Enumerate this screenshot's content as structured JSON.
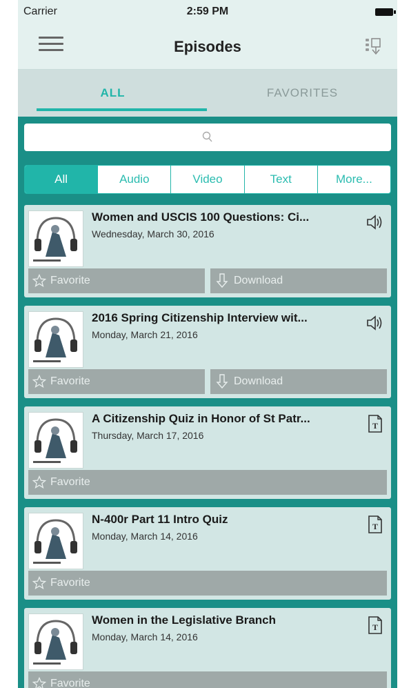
{
  "status_bar": {
    "carrier": "Carrier",
    "time": "2:59 PM"
  },
  "nav": {
    "title": "Episodes",
    "menu_icon": "hamburger-icon",
    "sort_icon": "sort-icon"
  },
  "tabs": [
    {
      "label": "ALL",
      "active": true
    },
    {
      "label": "FAVORITES",
      "active": false
    }
  ],
  "search": {
    "placeholder": "",
    "icon": "search-icon"
  },
  "filters": [
    {
      "label": "All",
      "active": true
    },
    {
      "label": "Audio",
      "active": false
    },
    {
      "label": "Video",
      "active": false
    },
    {
      "label": "Text",
      "active": false
    },
    {
      "label": "More...",
      "active": false
    }
  ],
  "episodes": [
    {
      "title": "Women and USCIS 100 Questions: Ci...",
      "date": "Wednesday, March 30, 2016",
      "type": "audio",
      "favorite_label": "Favorite",
      "download_label": "Download"
    },
    {
      "title": "2016 Spring Citizenship Interview wit...",
      "date": "Monday, March 21, 2016",
      "type": "audio",
      "favorite_label": "Favorite",
      "download_label": "Download"
    },
    {
      "title": "A Citizenship Quiz in Honor of St Patr...",
      "date": "Thursday, March 17, 2016",
      "type": "text",
      "favorite_label": "Favorite"
    },
    {
      "title": "N-400r Part 11 Intro Quiz",
      "date": "Monday, March 14, 2016",
      "type": "text",
      "favorite_label": "Favorite"
    },
    {
      "title": "Women in the Legislative Branch",
      "date": "Monday, March 14, 2016",
      "type": "text",
      "favorite_label": "Favorite"
    }
  ],
  "colors": {
    "accent": "#21b5a9",
    "background": "#1a8f87",
    "card": "#d2e6e4",
    "action": "#9fa9a8"
  }
}
